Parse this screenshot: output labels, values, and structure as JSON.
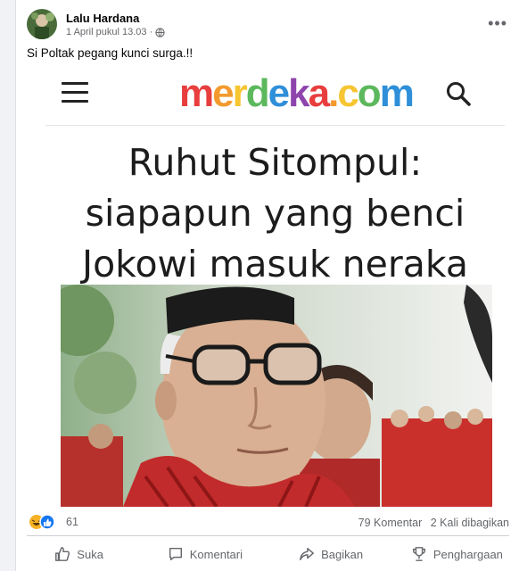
{
  "post": {
    "author": "Lalu Hardana",
    "timestamp": "1 April pukul 13.03 ·",
    "privacy_icon": "globe-icon",
    "caption": "Si Poltak pegang kunci surga.!!"
  },
  "article": {
    "logo_text": "merdeka.com",
    "logo_colors": [
      "#e83e3e",
      "#f29a2e",
      "#f6c531",
      "#5cb85c",
      "#2f8fd8",
      "#8e44ad"
    ],
    "headline_line1": "Ruhut Sitompul:",
    "headline_line2": "siapapun yang benci",
    "headline_line3": "Jokowi masuk neraka"
  },
  "engagement": {
    "reaction_count": "61",
    "comments": "79 Komentar",
    "shares": "2 Kali dibagikan"
  },
  "actions": {
    "like": "Suka",
    "comment": "Komentari",
    "share": "Bagikan",
    "award": "Penghargaan"
  },
  "colors": {
    "facebook_blue": "#1877f2",
    "haha_yellow": "#f7b125",
    "text_secondary": "#65676b"
  }
}
